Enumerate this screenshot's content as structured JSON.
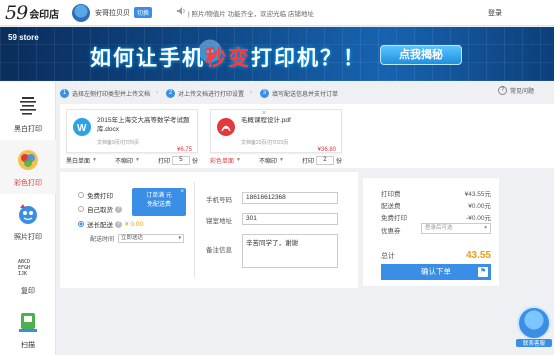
{
  "header": {
    "logo_brand": "59",
    "logo_text": "会印店",
    "user_name": "安哥拉贝贝",
    "switch_label": "切换",
    "marquee": "| 照片/物值片 功能齐全，欢迎光临 店铺地址",
    "login": "登录"
  },
  "banner": {
    "brand": "59 store",
    "title_before": "如何让手机",
    "title_highlight": "秒变",
    "title_after": "打印机？！",
    "button": "点我揭秘"
  },
  "sidebar": {
    "items": [
      {
        "label": "黑白打印",
        "icon": "bw-print-icon"
      },
      {
        "label": "彩色打印",
        "icon": "color-print-icon"
      },
      {
        "label": "照片打印",
        "icon": "photo-print-icon"
      },
      {
        "label": "复印",
        "icon": "copy-icon"
      },
      {
        "label": "扫描",
        "icon": "scan-icon"
      }
    ]
  },
  "steps": {
    "items": [
      {
        "num": "1",
        "text": "选择左侧打印类型并上传文档"
      },
      {
        "num": "2",
        "text": "对上传文档进行打印设置"
      },
      {
        "num": "3",
        "text": "填写配送信息并支付订单"
      }
    ],
    "faq": "常见问题"
  },
  "files": [
    {
      "name": "2015年上海交大高等数学考试题库.docx",
      "meta": "文档备9页/打印9页",
      "price": "¥6.75",
      "color_label": "黑白单面",
      "bind_label": "不缩印",
      "print_label": "打印",
      "copies": "5",
      "unit": "份",
      "icon": "word-icon",
      "icon_color": "#2aa3e8"
    },
    {
      "name": "毛概课程设计.pdf",
      "meta": "文档备23页/打印23页",
      "price": "¥36.80",
      "color_label": "彩色单面",
      "bind_label": "不缩印",
      "print_label": "打印",
      "copies": "2",
      "unit": "份",
      "icon": "pdf-icon",
      "icon_color": "#e4393c"
    }
  ],
  "delivery": {
    "options": [
      {
        "label": "免费打印",
        "checked": false
      },
      {
        "label": "自己取货",
        "checked": false
      },
      {
        "label": "送长配送",
        "checked": true,
        "fee": "¥ 0.00"
      }
    ],
    "tooltip_line1": "订单满 元",
    "tooltip_line2": "免配送费",
    "time_label": "配送时间",
    "time_value": "立即送达",
    "phone_label": "手机号码",
    "phone_value": "18616612368",
    "room_label": "寝室地址",
    "room_value": "301",
    "note_label": "备注信息",
    "note_value": "辛苦同学了，谢谢"
  },
  "summary": {
    "rows": [
      {
        "label": "打印费",
        "value": "¥43.55元"
      },
      {
        "label": "配送费",
        "value": "¥0.00元"
      },
      {
        "label": "免费打印",
        "value": "-¥0.00元"
      }
    ],
    "coupon_label": "优惠券",
    "coupon_placeholder": "登录后可选",
    "total_label": "总计",
    "total_value": "43.55",
    "confirm": "确认下单"
  },
  "support": {
    "label": "联系客服"
  },
  "colors": {
    "accent": "#3a8ee6",
    "price": "#e4393c",
    "total": "#f39c12"
  }
}
